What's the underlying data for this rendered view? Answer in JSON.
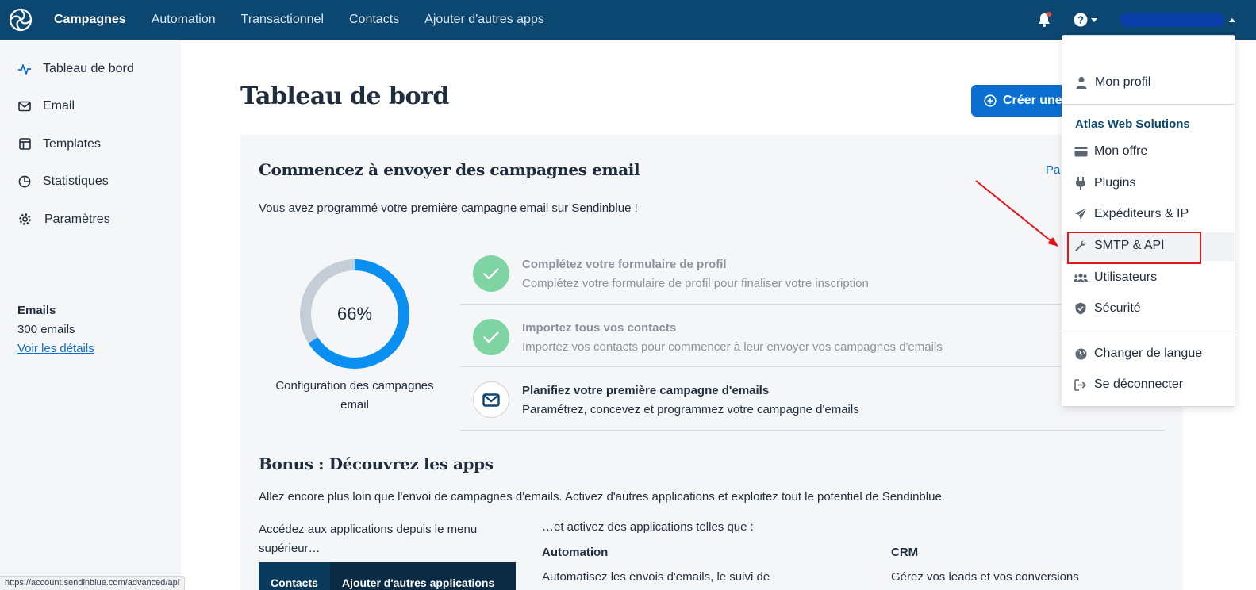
{
  "topnav": {
    "items": [
      "Campagnes",
      "Automation",
      "Transactionnel",
      "Contacts",
      "Ajouter d'autres apps"
    ],
    "active_index": 0,
    "icons": {
      "logo": "sendinblue-logo-icon",
      "bell": "bell-icon",
      "help": "help-circle-icon"
    }
  },
  "sidebar": {
    "items": [
      {
        "label": "Tableau de bord",
        "icon": "activity-icon"
      },
      {
        "label": "Email",
        "icon": "envelope-icon"
      },
      {
        "label": "Templates",
        "icon": "template-icon"
      },
      {
        "label": "Statistiques",
        "icon": "pie-chart-icon"
      },
      {
        "label": "Paramètres",
        "icon": "gear-icon"
      }
    ],
    "emails": {
      "title": "Emails",
      "count": "300 emails",
      "link": "Voir les détails"
    }
  },
  "main": {
    "title": "Tableau de bord",
    "create_button": "Créer une",
    "card": {
      "heading": "Commencez à envoyer des campagnes email",
      "link": "Pa",
      "subtitle": "Vous avez programmé votre première campagne email sur Sendinblue !",
      "progress_label": "66%",
      "progress_value": 0.66,
      "progress_caption": "Configuration des campagnes email",
      "steps": [
        {
          "title": "Complétez votre formulaire de profil",
          "desc": "Complétez votre formulaire de profil pour finaliser votre inscription",
          "done": true
        },
        {
          "title": "Importez tous vos contacts",
          "desc": "Importez vos contacts pour commencer à leur envoyer vos campagnes d'emails",
          "done": true
        },
        {
          "title": "Planifiez votre première campagne d'emails",
          "desc": "Paramétrez, concevez et programmez votre campagne d'emails",
          "done": false
        }
      ]
    },
    "bonus": {
      "heading": "Bonus : Découvrez les apps",
      "subtitle": "Allez encore plus loin que l'envoi de campagnes d'emails. Activez d'autres applications et exploitez tout le potentiel de Sendinblue.",
      "left_text": "Accédez aux applications depuis le menu supérieur…",
      "right_text": "…et activez des applications telles que :",
      "apps": [
        {
          "name": "Automation",
          "desc": "Automatisez les envois d'emails, le suivi de"
        },
        {
          "name": "CRM",
          "desc": "Gérez vos leads et vos conversions"
        }
      ],
      "mini_menu": [
        "Contacts",
        "Ajouter d'autres applications"
      ]
    }
  },
  "dropdown": {
    "profile": "Mon profil",
    "org": "Atlas Web Solutions",
    "items": [
      {
        "label": "Mon offre",
        "icon": "credit-card-icon"
      },
      {
        "label": "Plugins",
        "icon": "plug-icon"
      },
      {
        "label": "Expéditeurs & IP",
        "icon": "paper-plane-icon"
      },
      {
        "label": "SMTP & API",
        "icon": "wrench-icon"
      },
      {
        "label": "Utilisateurs",
        "icon": "users-icon"
      },
      {
        "label": "Sécurité",
        "icon": "shield-icon"
      }
    ],
    "language": "Changer de langue",
    "logout": "Se déconnecter"
  },
  "status_url": "https://account.sendinblue.com/advanced/api",
  "colors": {
    "topbar": "#0b4770",
    "accent": "#0b6fd1",
    "done": "#7fd4a3",
    "highlight": "#e8141b"
  }
}
